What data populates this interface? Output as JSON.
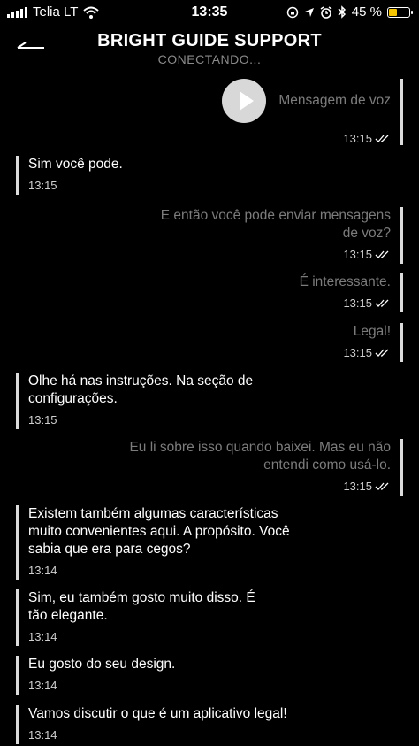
{
  "status": {
    "carrier": "Telia LT",
    "time": "13:35",
    "battery": "45 %",
    "battery_level": 0.45,
    "battery_color": "#f5c400"
  },
  "header": {
    "title": "BRIGHT GUIDE SUPPORT",
    "subtitle": "CONECTANDO..."
  },
  "messages": [
    {
      "dir": "out",
      "type": "voice",
      "text": "Mensagem de voz",
      "time": "13:15"
    },
    {
      "dir": "in",
      "text": "Sim você pode.",
      "time": "13:15"
    },
    {
      "dir": "out",
      "line1": "E então você pode enviar mensagens",
      "line2": "de voz?",
      "time": "13:15"
    },
    {
      "dir": "out",
      "text": "É interessante.",
      "time": "13:15"
    },
    {
      "dir": "out",
      "text": "Legal!",
      "time": "13:15"
    },
    {
      "dir": "in",
      "line1": "Olhe há nas instruções. Na seção de",
      "line2": "configurações.",
      "time": "13:15"
    },
    {
      "dir": "out",
      "line1": "Eu li sobre isso quando baixei. Mas eu não",
      "line2": "entendi como usá-lo.",
      "time": "13:15"
    },
    {
      "dir": "in",
      "line1": "Existem também algumas características",
      "line2": "muito convenientes aqui. A propósito. Você",
      "line3": "sabia que era para cegos?",
      "time": "13:14"
    },
    {
      "dir": "in",
      "line1": "Sim, eu também gosto muito disso. É",
      "line2": "tão elegante.",
      "time": "13:14"
    },
    {
      "dir": "in",
      "text": "Eu gosto do seu design.",
      "time": "13:14"
    },
    {
      "dir": "in",
      "text": "Vamos discutir o que é um aplicativo legal!",
      "time": "13:14"
    }
  ]
}
